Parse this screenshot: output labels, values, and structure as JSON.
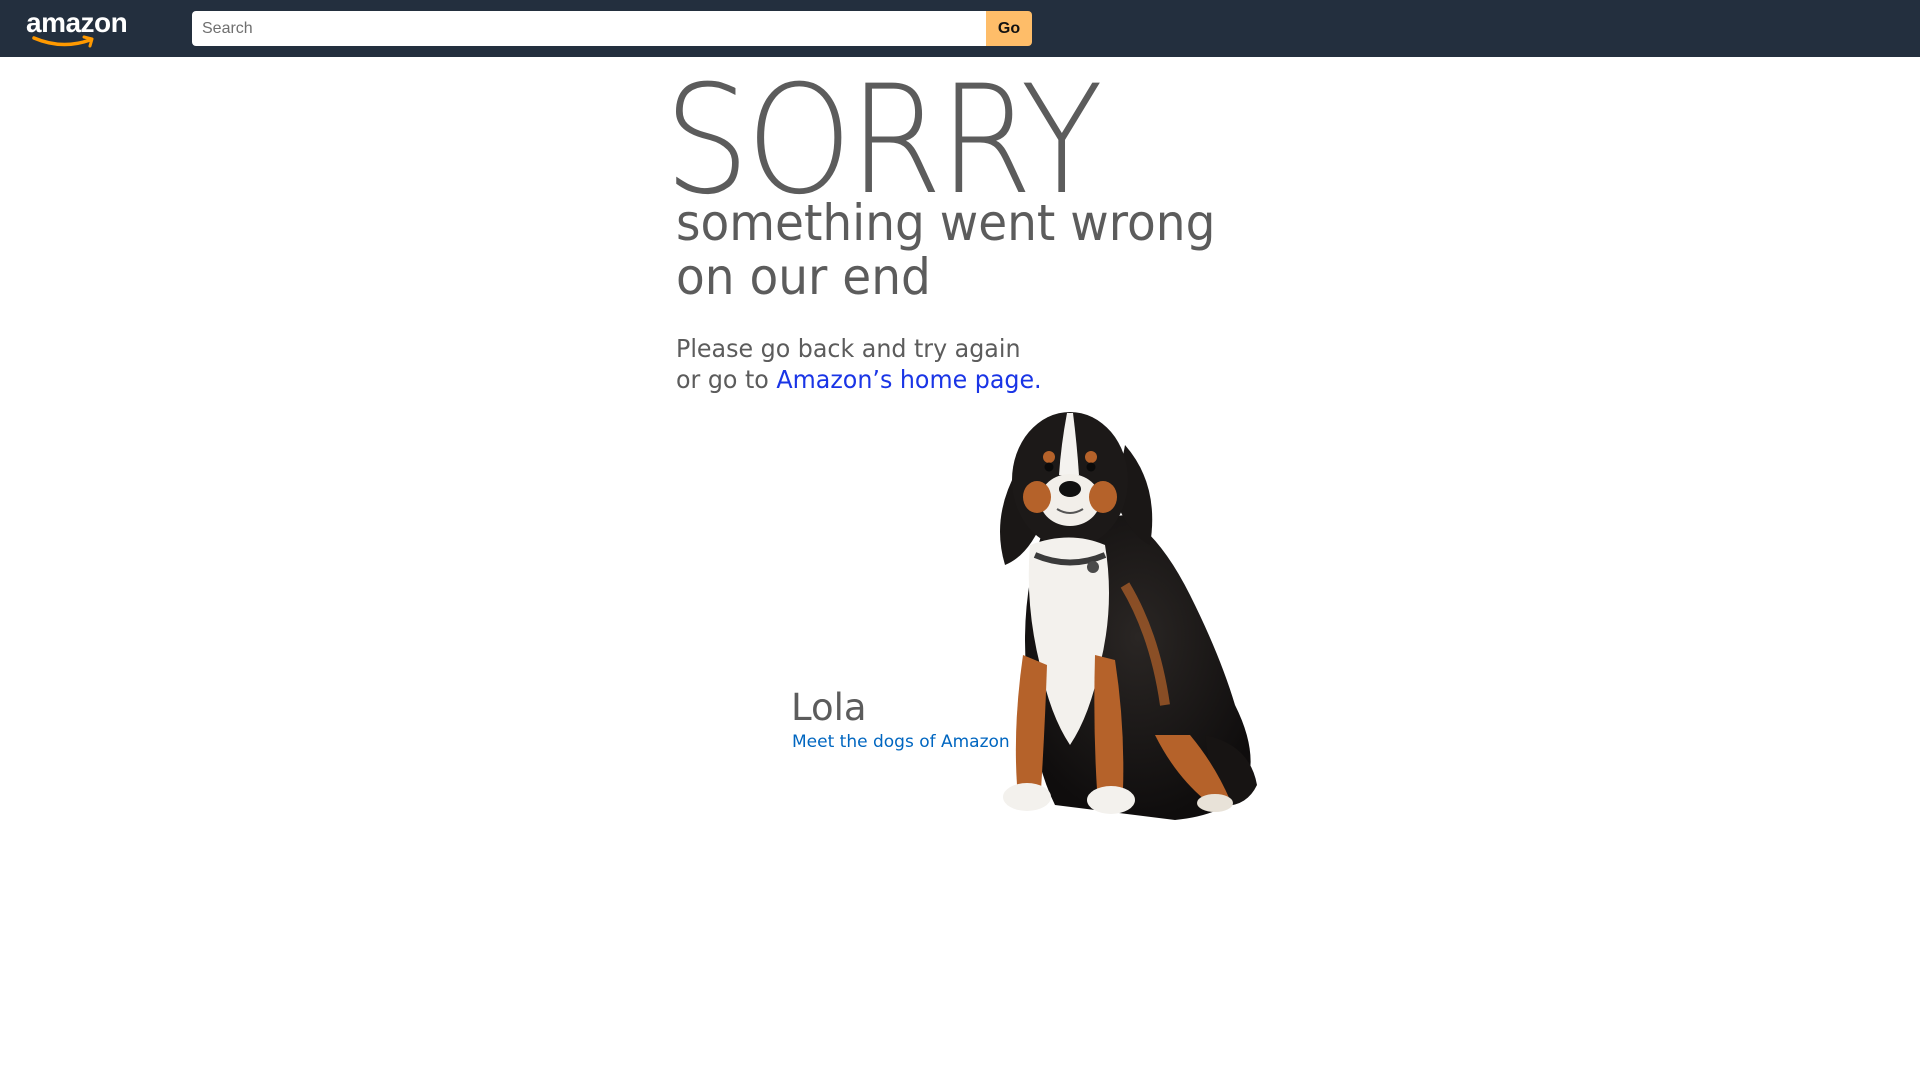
{
  "header": {
    "logo_text": "amazon",
    "search": {
      "placeholder": "Search",
      "value": ""
    },
    "go_label": "Go"
  },
  "error": {
    "headline": "SORRY",
    "subtitle_line1": "something went wrong",
    "subtitle_line2": "on our end",
    "message_line1": "Please go back and try again",
    "message_line2_prefix": "or go to ",
    "home_link_label": "Amazon’s home page."
  },
  "dog": {
    "name": "Lola",
    "link_label": "Meet the dogs of Amazon"
  },
  "colors": {
    "header_bg": "#232f3e",
    "go_button": "#febd69",
    "home_link": "#1a35e6",
    "dog_link": "#0066c0",
    "text_gray": "#5c5c5c",
    "smile_orange": "#ff9900"
  }
}
